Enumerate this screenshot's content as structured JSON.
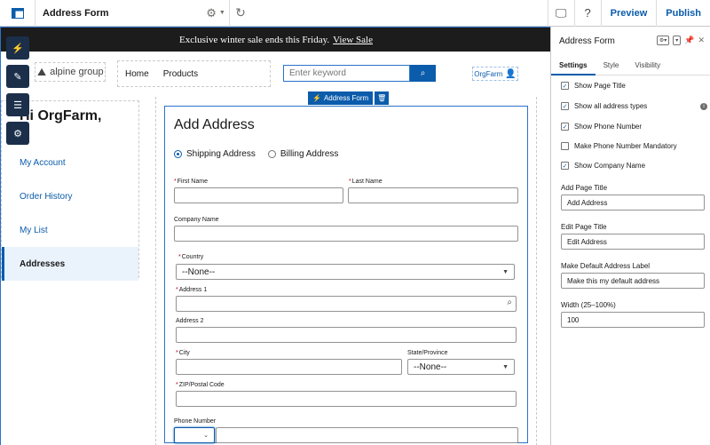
{
  "topbar": {
    "page_name": "Address Form",
    "preview_label": "Preview",
    "publish_label": "Publish"
  },
  "promo": {
    "text": "Exclusive winter sale ends this Friday.",
    "link": "View Sale"
  },
  "header": {
    "logo_text": "alpine group",
    "nav": [
      "Home",
      "Products"
    ],
    "search_placeholder": "Enter keyword",
    "account_name": "OrgFarm"
  },
  "sidebar": {
    "greeting": "Hi OrgFarm,",
    "items": [
      "My Account",
      "Order History",
      "My List",
      "Addresses"
    ],
    "active": "Addresses"
  },
  "component": {
    "label": "Address Form"
  },
  "form": {
    "title": "Add Address",
    "address_types": [
      "Shipping Address",
      "Billing Address"
    ],
    "selected_type": "Shipping Address",
    "first_name_label": "First Name",
    "last_name_label": "Last Name",
    "company_label": "Company Name",
    "country_label": "Country",
    "country_value": "--None--",
    "address1_label": "Address 1",
    "address2_label": "Address 2",
    "city_label": "City",
    "state_label": "State/Province",
    "state_value": "--None--",
    "zip_label": "ZIP/Postal Code",
    "phone_label": "Phone Number"
  },
  "panel": {
    "title": "Address Form",
    "tabs": [
      "Settings",
      "Style",
      "Visibility"
    ],
    "active_tab": "Settings",
    "checkboxes": [
      {
        "label": "Show Page Title",
        "checked": true
      },
      {
        "label": "Show all address types",
        "checked": true
      },
      {
        "label": "Show Phone Number",
        "checked": true
      },
      {
        "label": "Make Phone Number Mandatory",
        "checked": false
      },
      {
        "label": "Show Company Name",
        "checked": true
      }
    ],
    "add_title_label": "Add Page Title",
    "add_title_value": "Add Address",
    "edit_title_label": "Edit Page Title",
    "edit_title_value": "Edit Address",
    "default_label_label": "Make Default Address Label",
    "default_label_value": "Make this my default address",
    "width_label": "Width (25–100%)",
    "width_value": "100"
  },
  "colors": {
    "brand": "#0b5cab",
    "rail": "#1b2f4b",
    "promo_bg": "#1c1c1c",
    "required": "#ba0517"
  }
}
